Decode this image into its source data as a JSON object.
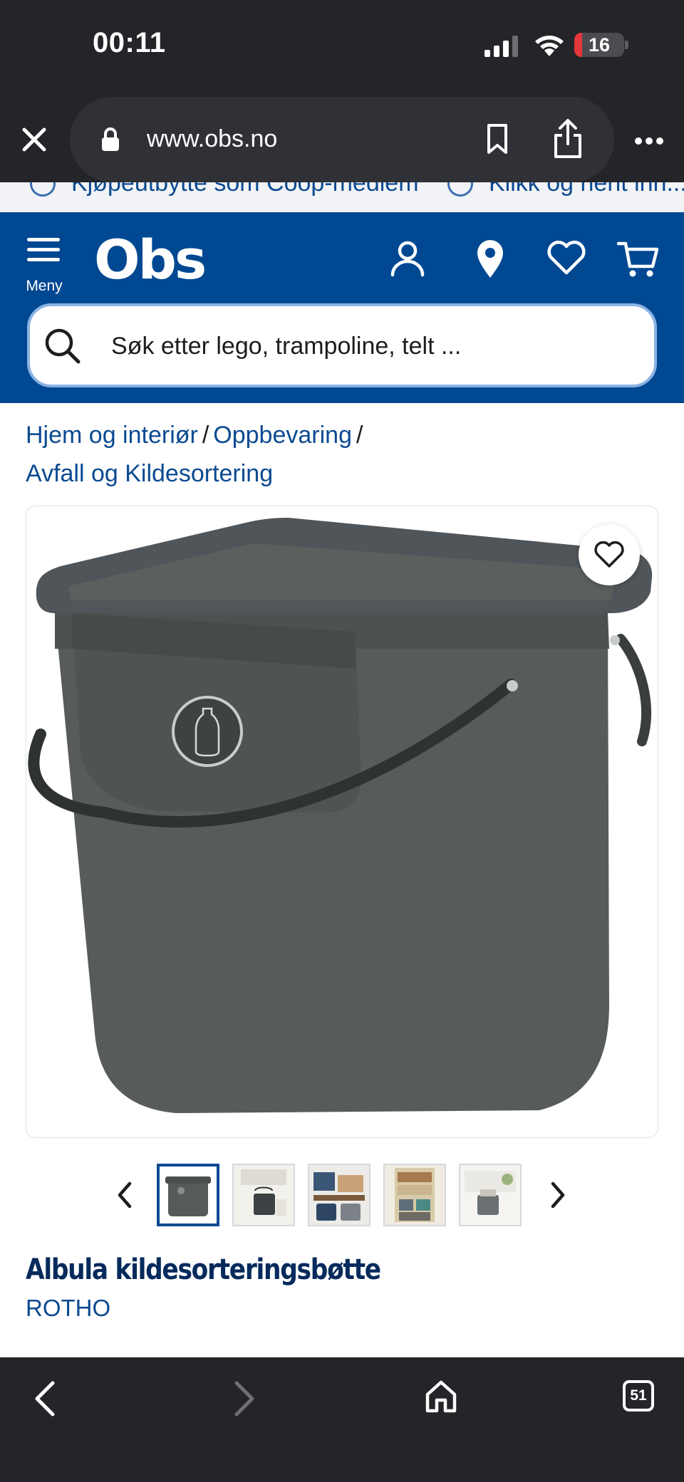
{
  "status_bar": {
    "time": "00:11",
    "battery": "16",
    "battery_level": 0.16
  },
  "browser": {
    "url": "www.obs.no",
    "tab_count": "51"
  },
  "promo": {
    "item1": "Kjøpeutbytte som Coop-medlem",
    "item2": "Klikk og hent inn..."
  },
  "header": {
    "logo": "Obs",
    "menu_label": "Meny",
    "search_placeholder": "Søk etter lego, trampoline, telt ..."
  },
  "breadcrumb": {
    "items": [
      "Hjem og interiør",
      "Oppbevaring",
      "Avfall og Kildesortering"
    ],
    "separator": "/"
  },
  "product": {
    "title": "Albula kildesorteringsbøtte",
    "brand": "ROTHO",
    "image_count": 5,
    "selected_image": 1
  },
  "colors": {
    "brand_blue": "#014893",
    "link_blue": "#0b4a91",
    "title_navy": "#062a5c",
    "chrome_dark": "#232529",
    "product_grey": "#555b58"
  },
  "icons": [
    "close-icon",
    "lock-icon",
    "bookmark-icon",
    "share-icon",
    "more-icon",
    "menu-icon",
    "account-icon",
    "location-icon",
    "heart-icon",
    "cart-icon",
    "search-icon",
    "chevron-left-icon",
    "chevron-right-icon",
    "back-icon",
    "forward-icon",
    "home-icon",
    "tabs-icon"
  ]
}
